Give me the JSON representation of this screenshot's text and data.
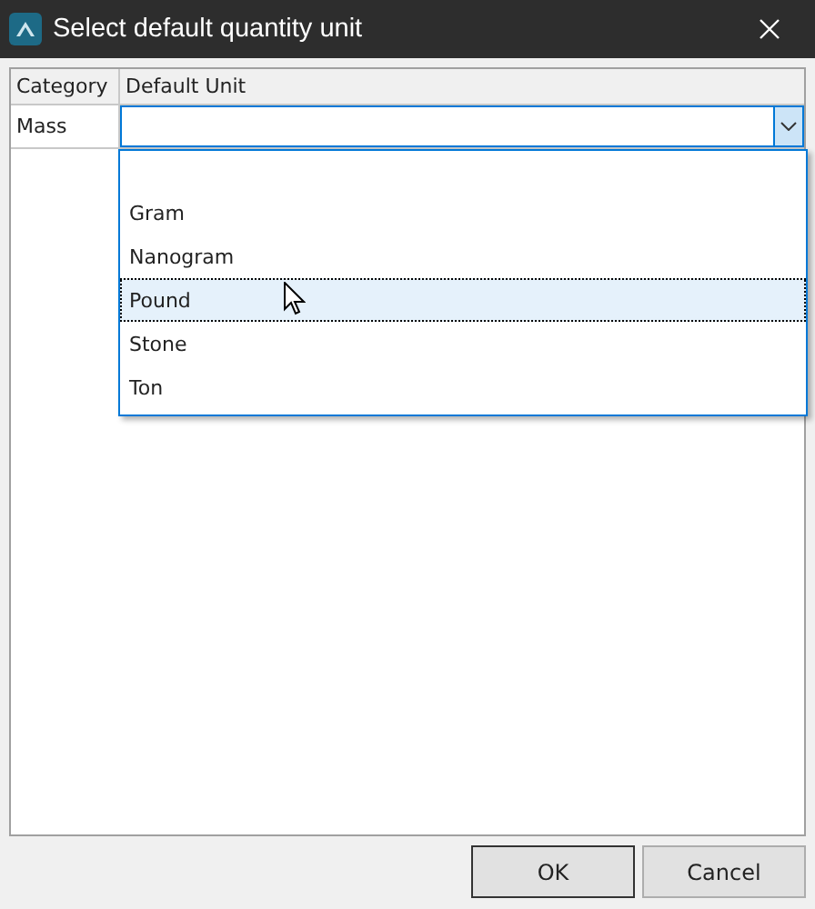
{
  "window": {
    "title": "Select default quantity unit"
  },
  "table": {
    "columns": [
      "Category",
      "Default Unit"
    ],
    "rows": [
      {
        "category": "Mass",
        "default_unit": ""
      }
    ]
  },
  "dropdown": {
    "options": [
      {
        "label": "Gram",
        "selected": false
      },
      {
        "label": "Nanogram",
        "selected": false
      },
      {
        "label": "Pound",
        "selected": true
      },
      {
        "label": "Stone",
        "selected": false
      },
      {
        "label": "Ton",
        "selected": false
      }
    ]
  },
  "buttons": [
    {
      "label": "OK",
      "kind": "default"
    },
    {
      "label": "Cancel",
      "kind": "normal"
    }
  ]
}
